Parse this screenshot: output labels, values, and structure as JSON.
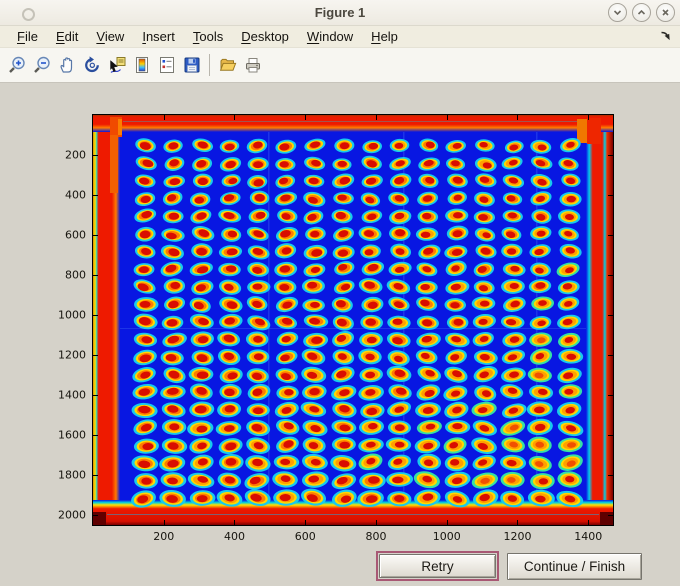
{
  "window": {
    "title": "Figure 1",
    "controls": {
      "minimize": "minimize",
      "maximize": "maximize",
      "close": "close"
    }
  },
  "menubar": {
    "items": [
      {
        "label": "File"
      },
      {
        "label": "Edit"
      },
      {
        "label": "View"
      },
      {
        "label": "Insert"
      },
      {
        "label": "Tools"
      },
      {
        "label": "Desktop"
      },
      {
        "label": "Window"
      },
      {
        "label": "Help"
      }
    ]
  },
  "toolbar": {
    "icons": [
      "zoom-in",
      "zoom-out",
      "pan",
      "rotate-3d",
      "data-cursor",
      "insert-colorbar",
      "insert-legend",
      "save-figure",
      "open-file",
      "print-figure"
    ]
  },
  "buttons": {
    "retry": "Retry",
    "continue": "Continue / Finish"
  },
  "colors": {
    "client_bg": "#d5d2c9",
    "titlebar_bg": "#f2f0e9",
    "menubar_bg": "#f0ede0",
    "toolbar_bg": "#f7f6f1",
    "focus_ring": "#a85874",
    "axis": "#000000"
  },
  "chart_data": {
    "type": "heatmap",
    "title": "",
    "xlabel": "",
    "ylabel": "",
    "xlim": [
      0,
      1470
    ],
    "ylim": [
      0,
      2050
    ],
    "y_axis_reversed": true,
    "xticks": [
      200,
      400,
      600,
      800,
      1000,
      1200,
      1400
    ],
    "yticks": [
      200,
      400,
      600,
      800,
      1000,
      1200,
      1400,
      1600,
      1800,
      2000
    ],
    "colormap": "jet",
    "description": "False-color (jet) image of a scanned microtiter plate: blue background, red/orange saturated border bands at all four edges, and a regular grid of assay spots (red/orange cores with yellow rings and cyan halos).",
    "grid": {
      "rows": 21,
      "cols": 16,
      "x_start": 147,
      "x_step": 80,
      "y_start": 155,
      "y_step": 88
    },
    "colors": {
      "background": "#0817e2",
      "spot_halo": "#17c9ee",
      "spot_ring": "#ffd800",
      "spot_mid": "#ff7c00",
      "spot_core": "#d90d00",
      "border_band": "#ee1a00",
      "border_accent": "#ff7a00",
      "streak_cyan": "#00d0e8",
      "streak_yellow": "#ffe000",
      "corner_dark": "#5f0000"
    }
  }
}
